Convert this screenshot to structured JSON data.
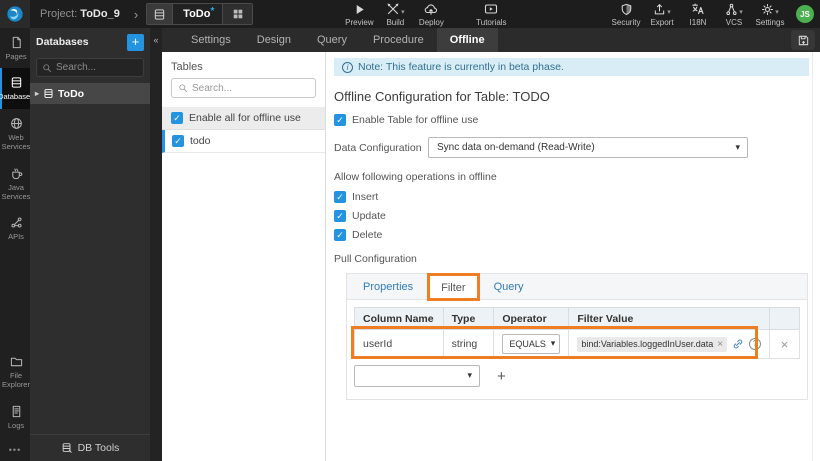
{
  "topbar": {
    "project_label": "Project:",
    "project_name": "ToDo_9",
    "entity": {
      "label": "ToDo",
      "dirty": "*"
    },
    "tools": [
      {
        "label": "Preview"
      },
      {
        "label": "Build"
      },
      {
        "label": "Deploy"
      },
      {
        "label": "Tutorials"
      },
      {
        "label": "Security"
      },
      {
        "label": "Export"
      },
      {
        "label": "I18N"
      },
      {
        "label": "VCS"
      },
      {
        "label": "Settings"
      }
    ],
    "avatar": "JS"
  },
  "rail": {
    "items": [
      {
        "label": "Pages",
        "active": false
      },
      {
        "label": "Databases",
        "active": true
      },
      {
        "label": "Web Services",
        "active": false
      },
      {
        "label": "Java Services",
        "active": false
      },
      {
        "label": "APIs",
        "active": false
      },
      {
        "label": "File Explorer",
        "active": false
      },
      {
        "label": "Logs",
        "active": false
      }
    ]
  },
  "db_panel": {
    "title": "Databases",
    "add_label": "+",
    "search_placeholder": "Search...",
    "items": [
      {
        "label": "ToDo",
        "selected": true
      }
    ],
    "footer_label": "DB Tools"
  },
  "tabstrip": {
    "tabs": [
      {
        "label": "Settings",
        "active": false
      },
      {
        "label": "Design",
        "active": false
      },
      {
        "label": "Query",
        "active": false
      },
      {
        "label": "Procedure",
        "active": false
      },
      {
        "label": "Offline",
        "active": true
      }
    ]
  },
  "tables_panel": {
    "title": "Tables",
    "search_placeholder": "Search...",
    "enable_all_label": "Enable all for offline use",
    "enable_all_checked": true,
    "rows": [
      {
        "label": "todo",
        "checked": true,
        "selected": true
      }
    ]
  },
  "offline": {
    "note": "Note: This feature is currently in beta phase.",
    "heading": "Offline Configuration for Table: TODO",
    "enable_table_label": "Enable Table for offline use",
    "enable_table_checked": true,
    "data_config_label": "Data Configuration",
    "data_config_value": "Sync data on-demand (Read-Write)",
    "operations_heading": "Allow following operations in offline",
    "operations": [
      {
        "label": "Insert",
        "checked": true
      },
      {
        "label": "Update",
        "checked": true
      },
      {
        "label": "Delete",
        "checked": true
      }
    ],
    "pull_config_label": "Pull Configuration",
    "pull_tabs": [
      {
        "label": "Properties",
        "active": false
      },
      {
        "label": "Filter",
        "active": true
      },
      {
        "label": "Query",
        "active": false
      }
    ],
    "filter_table": {
      "headers": [
        "Column Name",
        "Type",
        "Operator",
        "Filter Value"
      ],
      "rows": [
        {
          "column_name": "userId",
          "type": "string",
          "operator": "EQUALS",
          "filter_value": "bind:Variables.loggedInUser.data"
        }
      ],
      "add_label": "+"
    }
  },
  "colors": {
    "accent_blue": "#2594e0",
    "annotation_orange": "#ee7d23",
    "note_bg": "#d9edf7",
    "note_text": "#31708f",
    "link_blue": "#337ab7",
    "avatar_green": "#4caf50"
  }
}
